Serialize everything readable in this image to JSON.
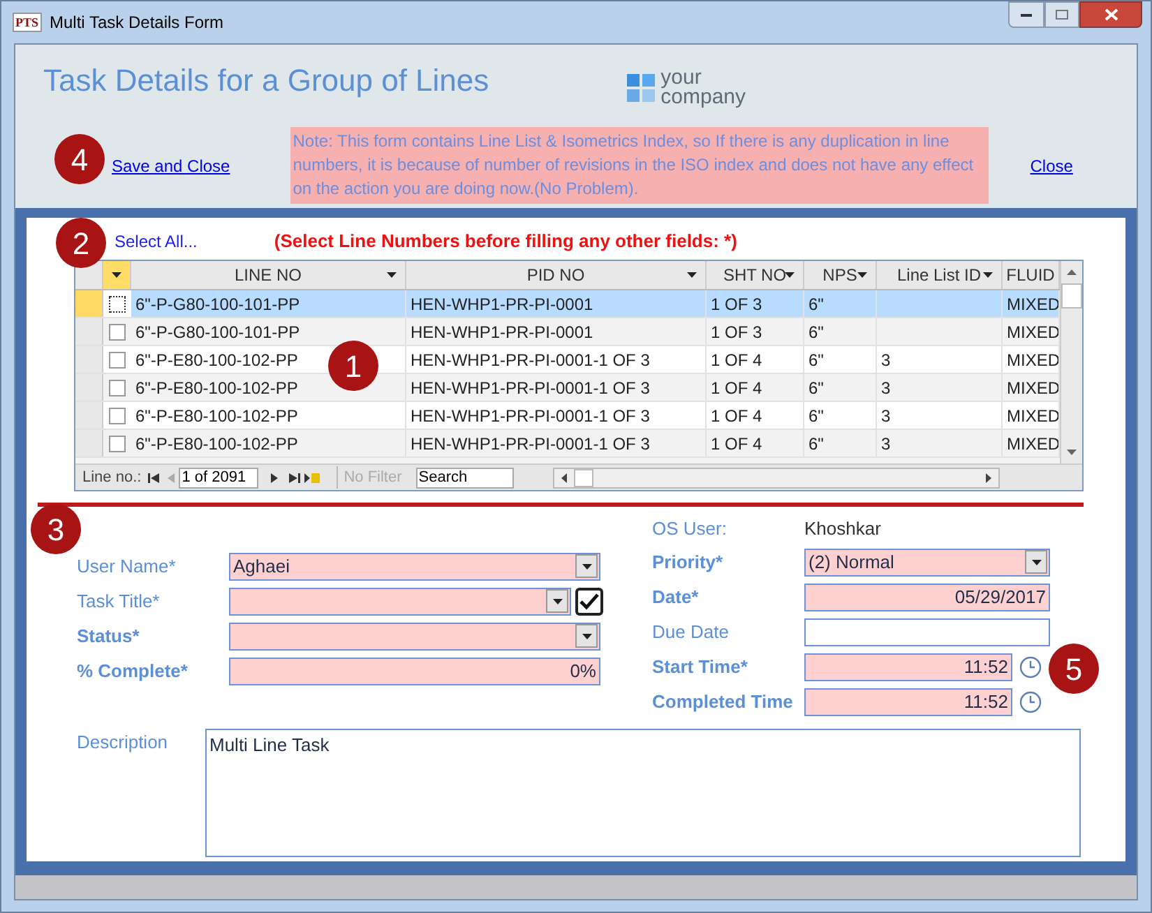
{
  "window": {
    "app_icon": "PTS",
    "title": "Multi Task Details Form"
  },
  "header": {
    "title": "Task Details for a Group of Lines",
    "logo": {
      "line_1": "your",
      "line_2": "company"
    },
    "save_link": "Save and Close",
    "note": "Note: This form contains Line List & Isometrics Index, so If there is any duplication in line numbers, it is because of number of revisions in the ISO index and does not have any effect on the action you are doing now.(No Problem).",
    "close_link": "Close"
  },
  "selection": {
    "select_all": "Select All...",
    "hint": "(Select Line Numbers before filling any other fields: *)"
  },
  "table": {
    "columns": [
      "LINE NO",
      "PID NO",
      "SHT NO",
      "NPS",
      "Line List ID",
      "FLUID"
    ],
    "rows": [
      {
        "selected": true,
        "checked": false,
        "cells": [
          "6\"-P-G80-100-101-PP",
          "HEN-WHP1-PR-PI-0001",
          "1 OF 3",
          "6\"",
          "",
          "MIXED"
        ]
      },
      {
        "selected": false,
        "checked": false,
        "cells": [
          "6\"-P-G80-100-101-PP",
          "HEN-WHP1-PR-PI-0001",
          "1 OF 3",
          "6\"",
          "",
          "MIXED"
        ]
      },
      {
        "selected": false,
        "checked": false,
        "cells": [
          "6\"-P-E80-100-102-PP",
          "HEN-WHP1-PR-PI-0001-1 OF 3",
          "1 OF 4",
          "6\"",
          "3",
          "MIXED"
        ]
      },
      {
        "selected": false,
        "checked": false,
        "cells": [
          "6\"-P-E80-100-102-PP",
          "HEN-WHP1-PR-PI-0001-1 OF 3",
          "1 OF 4",
          "6\"",
          "3",
          "MIXED"
        ]
      },
      {
        "selected": false,
        "checked": false,
        "cells": [
          "6\"-P-E80-100-102-PP",
          "HEN-WHP1-PR-PI-0001-1 OF 3",
          "1 OF 4",
          "6\"",
          "3",
          "MIXED"
        ]
      },
      {
        "selected": false,
        "checked": false,
        "cells": [
          "6\"-P-E80-100-102-PP",
          "HEN-WHP1-PR-PI-0001-1 OF 3",
          "1 OF 4",
          "6\"",
          "3",
          "MIXED"
        ]
      }
    ],
    "navigator": {
      "label": "Line no.:",
      "record": "1 of 2091",
      "filter": "No Filter",
      "filter_disabled": true,
      "search_placeholder": "Search"
    }
  },
  "os_user": {
    "label": "OS User:",
    "value": "Khoshkar"
  },
  "left_fields": [
    {
      "label": "User Name*",
      "bold": false,
      "kind": "combo",
      "value": "Aghaei",
      "highlighted": true
    },
    {
      "label": "Task Title*",
      "bold": false,
      "kind": "combo_check",
      "highlighted": true,
      "checked": true
    },
    {
      "label": "Status*",
      "bold": true,
      "kind": "combo",
      "highlighted": true
    },
    {
      "label": "% Complete*",
      "bold": true,
      "kind": "number",
      "value": "0%",
      "highlighted": true
    }
  ],
  "right_fields": [
    {
      "label": "Priority*",
      "bold": true,
      "kind": "combo",
      "value": "(2) Normal",
      "highlighted": true
    },
    {
      "label": "Date*",
      "bold": true,
      "kind": "number",
      "value": "05/29/2017",
      "highlighted": true
    },
    {
      "label": "Due Date",
      "bold": false,
      "kind": "number",
      "highlighted": false
    },
    {
      "label": "Start Time*",
      "bold": true,
      "kind": "time",
      "value": "11:52",
      "highlighted": true
    },
    {
      "label": "Completed Time",
      "bold": true,
      "kind": "time",
      "value": "11:52",
      "highlighted": true
    }
  ],
  "description": {
    "label": "Description",
    "value": "Multi Line Task"
  },
  "markers": [
    "1",
    "2",
    "3",
    "4",
    "5"
  ]
}
